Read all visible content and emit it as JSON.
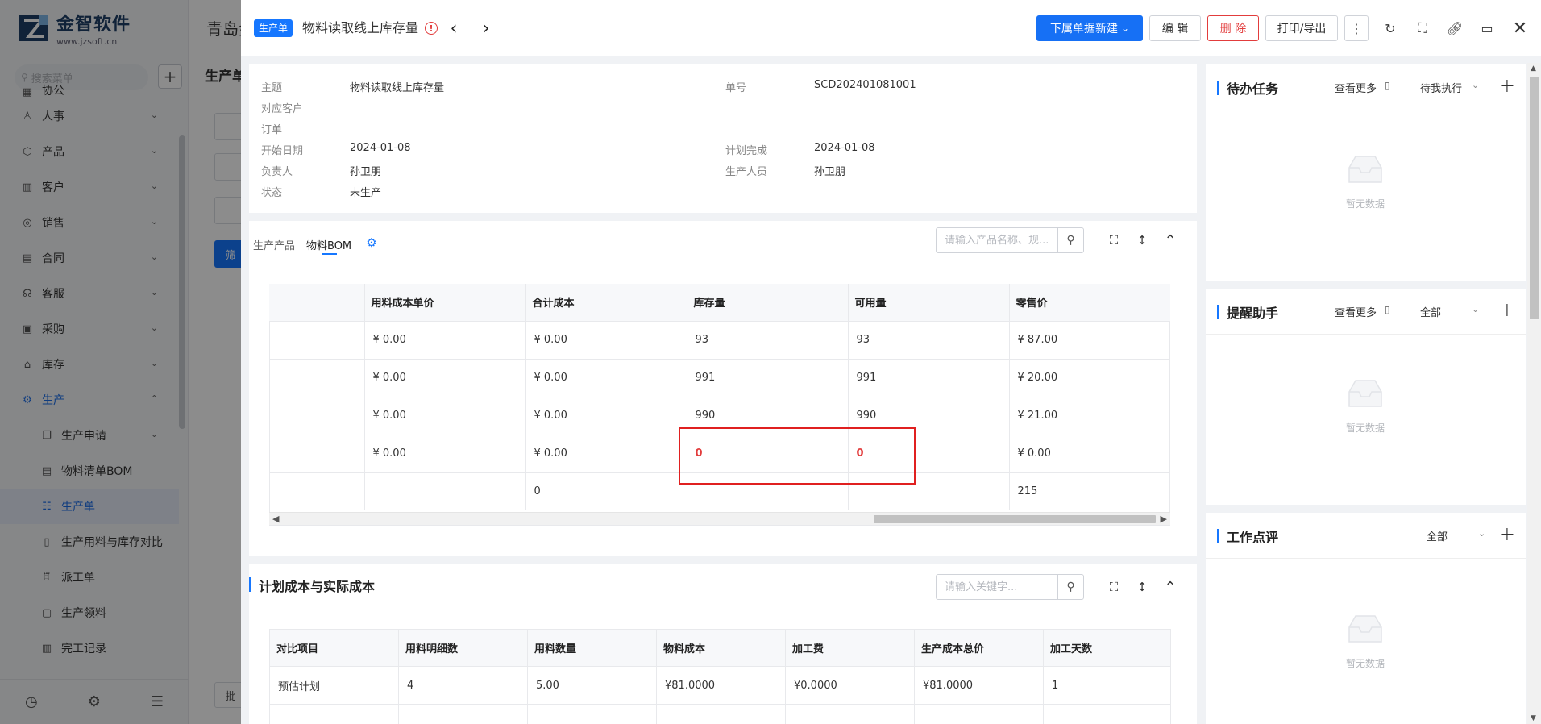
{
  "background": {
    "logo": {
      "name": "金智软件",
      "url": "www.jzsoft.cn"
    },
    "search_placeholder": "搜索菜单",
    "menu": [
      {
        "label": "协公",
        "icon": "office-icon"
      },
      {
        "label": "人事",
        "icon": "person-icon"
      },
      {
        "label": "产品",
        "icon": "cube-icon"
      },
      {
        "label": "客户",
        "icon": "chart-icon"
      },
      {
        "label": "销售",
        "icon": "coin-icon"
      },
      {
        "label": "合同",
        "icon": "contract-icon"
      },
      {
        "label": "客服",
        "icon": "headset-icon"
      },
      {
        "label": "采购",
        "icon": "bag-icon"
      },
      {
        "label": "库存",
        "icon": "warehouse-icon"
      },
      {
        "label": "生产",
        "icon": "factory-icon"
      }
    ],
    "submenu": [
      {
        "label": "生产申请"
      },
      {
        "label": "物料清单BOM"
      },
      {
        "label": "生产单"
      },
      {
        "label": "生产用料与库存对比"
      },
      {
        "label": "派工单"
      },
      {
        "label": "生产领料"
      },
      {
        "label": "完工记录"
      }
    ],
    "page_title": "青岛金",
    "page_sub": "生产单",
    "filter_btn": "筛",
    "bottom_left_btn": "批"
  },
  "drawer": {
    "tag": "生产单",
    "title": "物料读取线上库存量",
    "actions": {
      "new_sub": "下属单据新建",
      "edit": "编 辑",
      "delete": "删 除",
      "print": "打印/导出"
    },
    "info": {
      "left": [
        {
          "label": "主题",
          "value": "物料读取线上库存量"
        },
        {
          "label": "对应客户",
          "value": ""
        },
        {
          "label": "订单",
          "value": ""
        },
        {
          "label": "开始日期",
          "value": "2024-01-08"
        },
        {
          "label": "负责人",
          "value": "孙卫朋"
        },
        {
          "label": "状态",
          "value": "未生产"
        }
      ],
      "right": [
        {
          "label": "单号",
          "value": "SCD202401081001"
        },
        {
          "label": "计划完成",
          "value": "2024-01-08"
        },
        {
          "label": "生产人员",
          "value": "孙卫朋"
        }
      ]
    },
    "bom": {
      "tabs": [
        "生产产品",
        "物料BOM"
      ],
      "search_placeholder": "请输入产品名称、规...",
      "columns": [
        "",
        "用料成本单价",
        "合计成本",
        "库存量",
        "可用量",
        "零售价"
      ],
      "rows": [
        [
          "",
          "¥ 0.00",
          "¥ 0.00",
          "93",
          "93",
          "¥ 87.00"
        ],
        [
          "",
          "¥ 0.00",
          "¥ 0.00",
          "991",
          "991",
          "¥ 20.00"
        ],
        [
          "",
          "¥ 0.00",
          "¥ 0.00",
          "990",
          "990",
          "¥ 21.00"
        ],
        [
          "",
          "¥ 0.00",
          "¥ 0.00",
          "0",
          "0",
          "¥ 0.00"
        ],
        [
          "",
          "",
          "0",
          "",
          "",
          "215"
        ]
      ]
    },
    "plan": {
      "title": "计划成本与实际成本",
      "search_placeholder": "请输入关键字...",
      "columns": [
        "对比项目",
        "用料明细数",
        "用料数量",
        "物料成本",
        "加工费",
        "生产成本总价",
        "加工天数"
      ],
      "rows": [
        [
          "预估计划",
          "4",
          "5.00",
          "¥81.0000",
          "¥0.0000",
          "¥81.0000",
          "1"
        ]
      ]
    },
    "side": {
      "todo": {
        "title": "待办任务",
        "more": "查看更多",
        "filter": "待我执行",
        "empty": "暂无数据"
      },
      "remind": {
        "title": "提醒助手",
        "more": "查看更多",
        "filter": "全部",
        "empty": "暂无数据"
      },
      "review": {
        "title": "工作点评",
        "filter": "全部",
        "empty": "暂无数据"
      }
    }
  }
}
